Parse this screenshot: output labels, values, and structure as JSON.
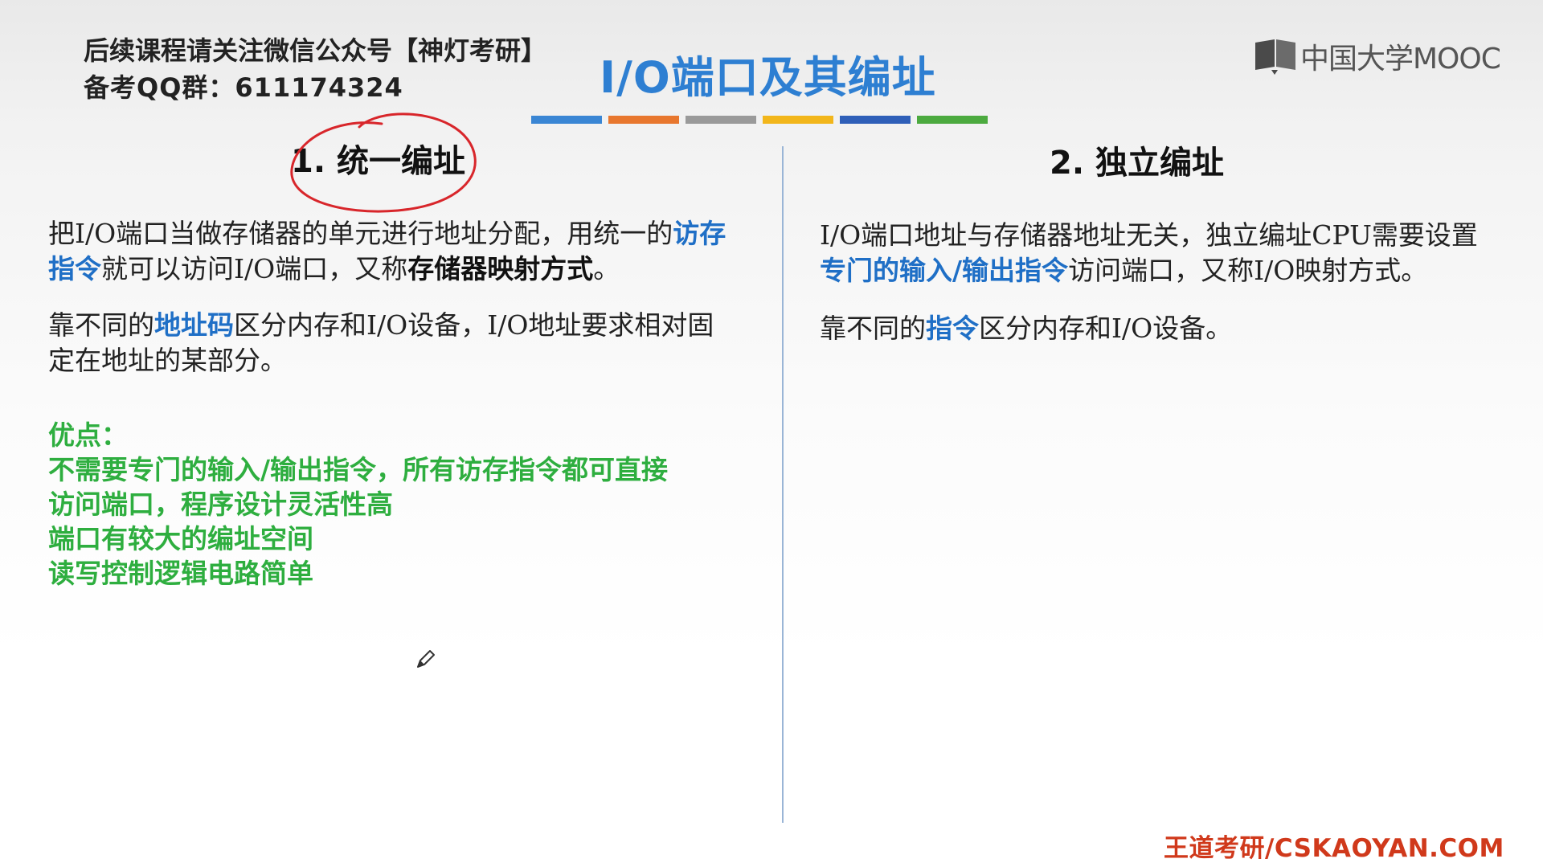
{
  "header": {
    "notice_line1": "后续课程请关注微信公众号【神灯考研】",
    "notice_line2": "备考QQ群：611174324",
    "title": "I/O端口及其编址",
    "logo_text": "中国大学MOOC",
    "color_bar": [
      "#3a86d4",
      "#e8772e",
      "#9a9a9a",
      "#f2b61b",
      "#2f5fb8",
      "#4caa3f"
    ]
  },
  "left": {
    "heading": "1. 统一编址",
    "p1": {
      "a": "把I/O端口当做存储器的单元进行地址分配，用统一的",
      "b_blue": "访存指令",
      "c": "就可以访问I/O端口，又称",
      "d_bold": "存储器映射方式",
      "e": "。"
    },
    "p2": {
      "a": "靠不同的",
      "b_blue": "地址码",
      "c": "区分内存和I/O设备，I/O地址要求相对固定在地址的某部分。"
    },
    "advantages_title": "优点：",
    "advantages": [
      "不需要专门的输入/输出指令，所有访存指令都可直接",
      "访问端口，程序设计灵活性高",
      "端口有较大的编址空间",
      "读写控制逻辑电路简单"
    ]
  },
  "right": {
    "heading": "2. 独立编址",
    "p1": {
      "a": "I/O端口地址与存储器地址无关，独立编址CPU需要设置",
      "b_blue": "专门的输入/输出指令",
      "c": "访问端口，又称I/O映射方式。"
    },
    "p2": {
      "a": "靠不同的",
      "b_blue": "指令",
      "c": "区分内存和I/O设备。"
    }
  },
  "footer": "王道考研/CSKAOYAN.COM",
  "annotation_color": "#d8262b"
}
